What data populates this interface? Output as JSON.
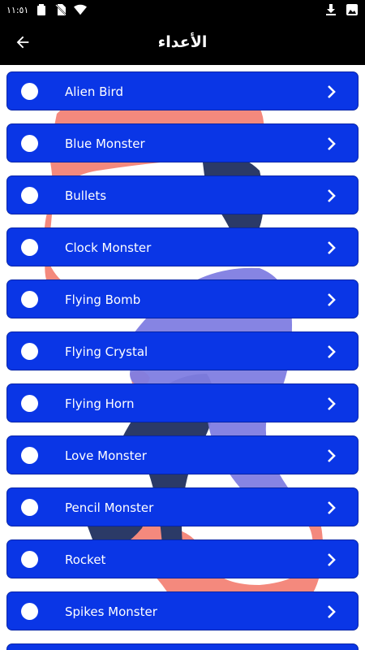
{
  "status_bar": {
    "time": "١١:٥١",
    "left_icons": [
      "battery-icon",
      "no-sim-icon",
      "wifi-icon"
    ],
    "right_icons": [
      "download-icon",
      "image-icon"
    ]
  },
  "app_bar": {
    "title": "الأعداء",
    "back_icon": "arrow-back-icon"
  },
  "colors": {
    "accent": "#0a36e6",
    "app_bar": "#000000",
    "illustration_pink": "#f4897d",
    "illustration_purple": "#7f7de2",
    "illustration_navy": "#2b3a67"
  },
  "enemies": [
    {
      "label": "Alien Bird"
    },
    {
      "label": "Blue Monster"
    },
    {
      "label": "Bullets"
    },
    {
      "label": "Clock Monster"
    },
    {
      "label": "Flying Bomb"
    },
    {
      "label": "Flying Crystal"
    },
    {
      "label": "Flying Horn"
    },
    {
      "label": "Love Monster"
    },
    {
      "label": "Pencil Monster"
    },
    {
      "label": "Rocket"
    },
    {
      "label": "Spikes Monster"
    },
    {
      "label": ""
    }
  ]
}
